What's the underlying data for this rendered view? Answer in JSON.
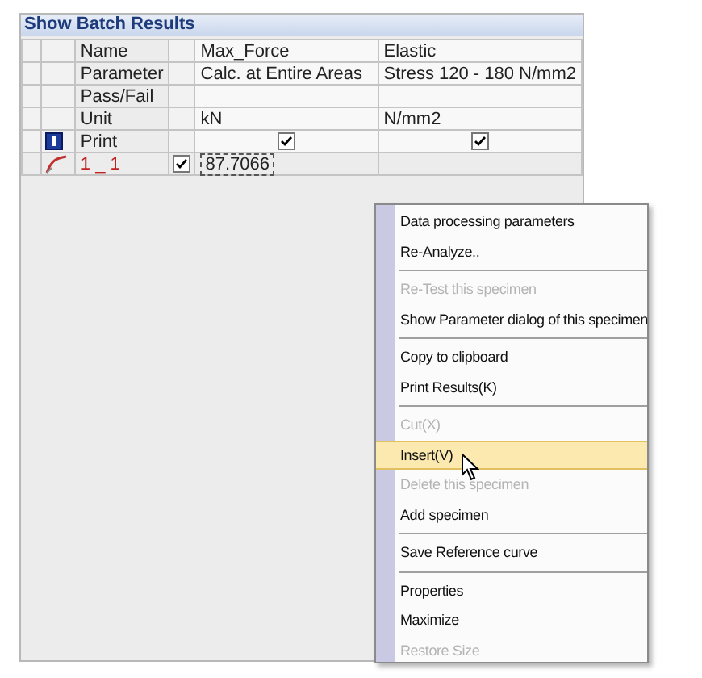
{
  "window": {
    "title": "Show Batch Results"
  },
  "table": {
    "rows": [
      {
        "kind": "text",
        "label": "Name",
        "cells": [
          "Max_Force",
          "Elastic"
        ]
      },
      {
        "kind": "text",
        "label": "Parameter",
        "cells": [
          "Calc. at Entire Areas",
          "Stress 120 - 180 N/mm2"
        ]
      },
      {
        "kind": "text",
        "label": "Pass/Fail",
        "cells": []
      },
      {
        "kind": "text",
        "label": "Unit",
        "cells": [
          "kN",
          "N/mm2"
        ]
      },
      {
        "kind": "check",
        "label": "Print",
        "checks": [
          true,
          true
        ]
      },
      {
        "kind": "specimen",
        "label": "1 _ 1",
        "checked": true,
        "cells": [
          "87.7066"
        ]
      }
    ]
  },
  "context_menu": {
    "items": [
      {
        "kind": "item",
        "label": "Data processing parameters",
        "disabled": false,
        "selected": false
      },
      {
        "kind": "item",
        "label": "Re-Analyze..",
        "disabled": false,
        "selected": false
      },
      {
        "kind": "separator"
      },
      {
        "kind": "item",
        "label": "Re-Test this specimen",
        "disabled": true,
        "selected": false
      },
      {
        "kind": "item",
        "label": "Show Parameter dialog of this specimen",
        "disabled": false,
        "selected": false
      },
      {
        "kind": "separator"
      },
      {
        "kind": "item",
        "label": "Copy to clipboard",
        "disabled": false,
        "selected": false
      },
      {
        "kind": "item",
        "label": "Print Results(K)",
        "disabled": false,
        "selected": false
      },
      {
        "kind": "separator"
      },
      {
        "kind": "item",
        "label": "Cut(X)",
        "disabled": true,
        "selected": false
      },
      {
        "kind": "item",
        "label": "Insert(V)",
        "disabled": false,
        "selected": true
      },
      {
        "kind": "item",
        "label": "Delete this specimen",
        "disabled": true,
        "selected": false
      },
      {
        "kind": "item",
        "label": "Add specimen",
        "disabled": false,
        "selected": false
      },
      {
        "kind": "separator"
      },
      {
        "kind": "item",
        "label": "Save Reference curve",
        "disabled": false,
        "selected": false
      },
      {
        "kind": "separator"
      },
      {
        "kind": "item",
        "label": "Properties",
        "disabled": false,
        "selected": false
      },
      {
        "kind": "item",
        "label": "Maximize",
        "disabled": false,
        "selected": false
      },
      {
        "kind": "item",
        "label": "Restore Size",
        "disabled": true,
        "selected": false
      }
    ]
  }
}
